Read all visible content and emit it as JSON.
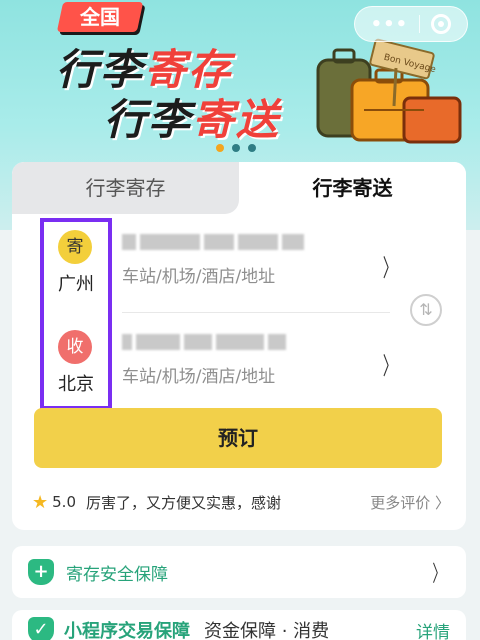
{
  "banner": {
    "badge": "全国",
    "line1_part1": "行李",
    "line1_part2": "寄存",
    "line2_part1": "行李",
    "line2_part2": "寄送",
    "capsule": {
      "more": "•••",
      "close_icon": "target-icon"
    },
    "carousel_active_index": 0
  },
  "tabs": {
    "storage": "行李寄存",
    "shipping": "行李寄送",
    "active": "shipping"
  },
  "sender": {
    "stamp": "寄",
    "city": "广州",
    "hint": "车站/机场/酒店/地址"
  },
  "receiver": {
    "stamp": "收",
    "city": "北京",
    "hint": "车站/机场/酒店/地址"
  },
  "actions": {
    "book": "预订",
    "swap_icon": "swap-icon"
  },
  "review": {
    "score": "5.0",
    "text": "厉害了，又方便又实惠，感谢",
    "more": "更多评价 〉"
  },
  "guarantee": {
    "label": "寄存安全保障"
  },
  "bottom": {
    "title": "小程序交易保障",
    "subtitle": "资金保障 · 消费",
    "details": "详情"
  },
  "colors": {
    "accent": "#f2d04a",
    "green": "#27a37a",
    "highlight": "#7a2ef2"
  }
}
